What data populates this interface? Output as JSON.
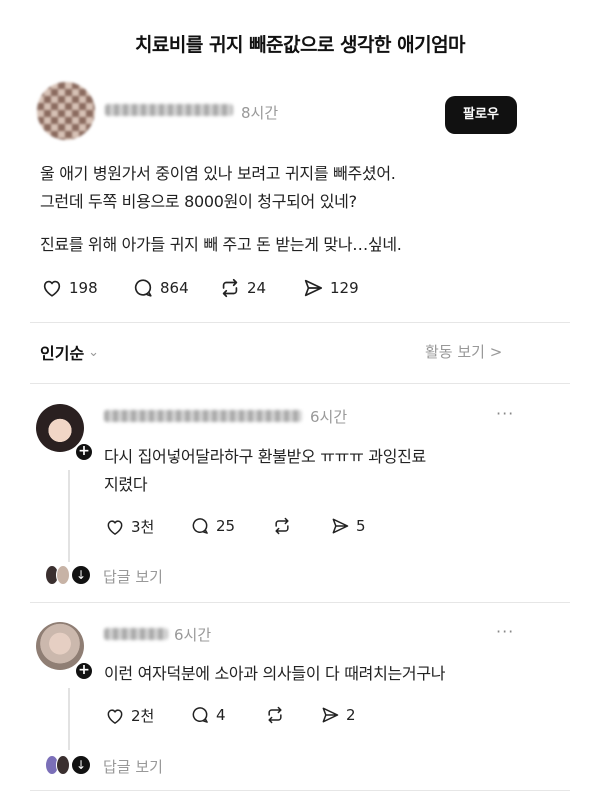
{
  "headline": "치료비를 귀지 빼준값으로 생각한 애기엄마",
  "post": {
    "time": "8시간",
    "follow_label": "팔로우",
    "lines": [
      "울 애기 병원가서 중이염 있나 보려고 귀지를 빼주셨어.",
      "그런데 두쪽 비용으로 8000원이 청구되어 있네?",
      "진료를 위해 아가들 귀지 빼 주고 돈 받는게 맞나…싶네."
    ],
    "likes": "198",
    "comments": "864",
    "reposts": "24",
    "shares": "129"
  },
  "sort": {
    "label": "인기순",
    "activity": "활동 보기 >"
  },
  "comments": [
    {
      "time": "6시간",
      "text_lines": [
        "다시 집어넣어달라하구 환불받오 ㅠㅠㅠ 과잉진료",
        "지렸다"
      ],
      "likes": "3천",
      "comments": "25",
      "shares": "5",
      "reply_label": "답글 보기"
    },
    {
      "time": "6시간",
      "text_lines": [
        "이런 여자덕분에 소아과 의사들이 다 때려치는거구나"
      ],
      "likes": "2천",
      "comments": "4",
      "shares": "2",
      "reply_label": "답글 보기"
    }
  ],
  "icons": {
    "like": "heart-icon",
    "comment": "comment-bubble-icon",
    "repost": "repost-icon",
    "share": "send-icon",
    "more": "more-dots-icon",
    "chevron": "chevron-down-icon"
  }
}
